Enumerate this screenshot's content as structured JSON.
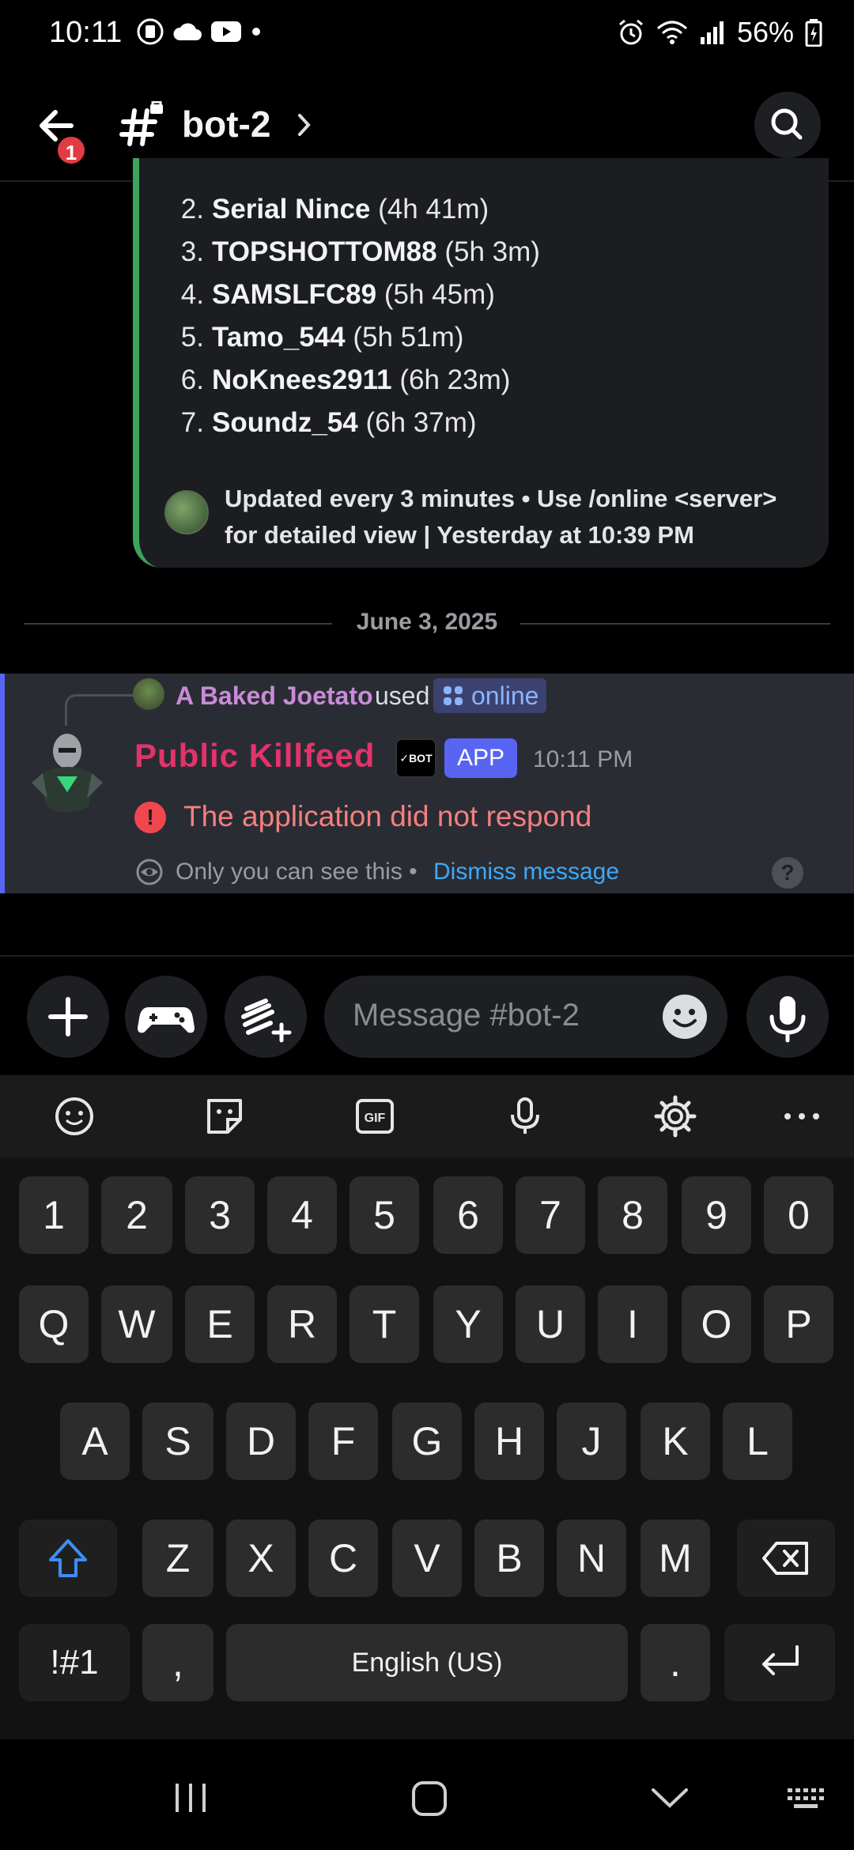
{
  "status_bar": {
    "time": "10:11",
    "battery": "56%"
  },
  "header": {
    "back_badge": "1",
    "channel_name": "bot-2"
  },
  "embed": {
    "rows": [
      {
        "num": "2.",
        "name": "Serial Nince",
        "time": "(4h 41m)"
      },
      {
        "num": "3.",
        "name": "TOPSHOTTOM88",
        "time": "(5h 3m)"
      },
      {
        "num": "4.",
        "name": "SAMSLFC89",
        "time": "(5h 45m)"
      },
      {
        "num": "5.",
        "name": "Tamo_544",
        "time": "(5h 51m)"
      },
      {
        "num": "6.",
        "name": "NoKnees2911",
        "time": "(6h 23m)"
      },
      {
        "num": "7.",
        "name": "Soundz_54",
        "time": "(6h 37m)"
      }
    ],
    "footer_line1": "Updated every 3 minutes • Use /online <server>",
    "footer_line2": "for detailed view | Yesterday at 10:39 PM"
  },
  "date_divider": "June 3, 2025",
  "message": {
    "reply_user": "A Baked Joetato",
    "reply_used": "used",
    "reply_command": "online",
    "bot_name": "Public Killfeed",
    "bot_badge": "✓BOT",
    "app_badge": "APP",
    "time": "10:11 PM",
    "error": "The application did not respond",
    "only_you": "Only you can see this •",
    "dismiss": "Dismiss message",
    "help": "?"
  },
  "composer": {
    "placeholder": "Message #bot-2"
  },
  "keyboard": {
    "numbers": [
      "1",
      "2",
      "3",
      "4",
      "5",
      "6",
      "7",
      "8",
      "9",
      "0"
    ],
    "row1": [
      "Q",
      "W",
      "E",
      "R",
      "T",
      "Y",
      "U",
      "I",
      "O",
      "P"
    ],
    "row2": [
      "A",
      "S",
      "D",
      "F",
      "G",
      "H",
      "J",
      "K",
      "L"
    ],
    "row3": [
      "Z",
      "X",
      "C",
      "V",
      "B",
      "N",
      "M"
    ],
    "symbols": "!#1",
    "comma": ",",
    "space": "English (US)",
    "period": "."
  },
  "colors": {
    "accent": "#5865f2",
    "embed_bar": "#3ba55d",
    "error": "#f57f7f",
    "bot_name": "#e3336b",
    "link": "#3fa9f5"
  }
}
